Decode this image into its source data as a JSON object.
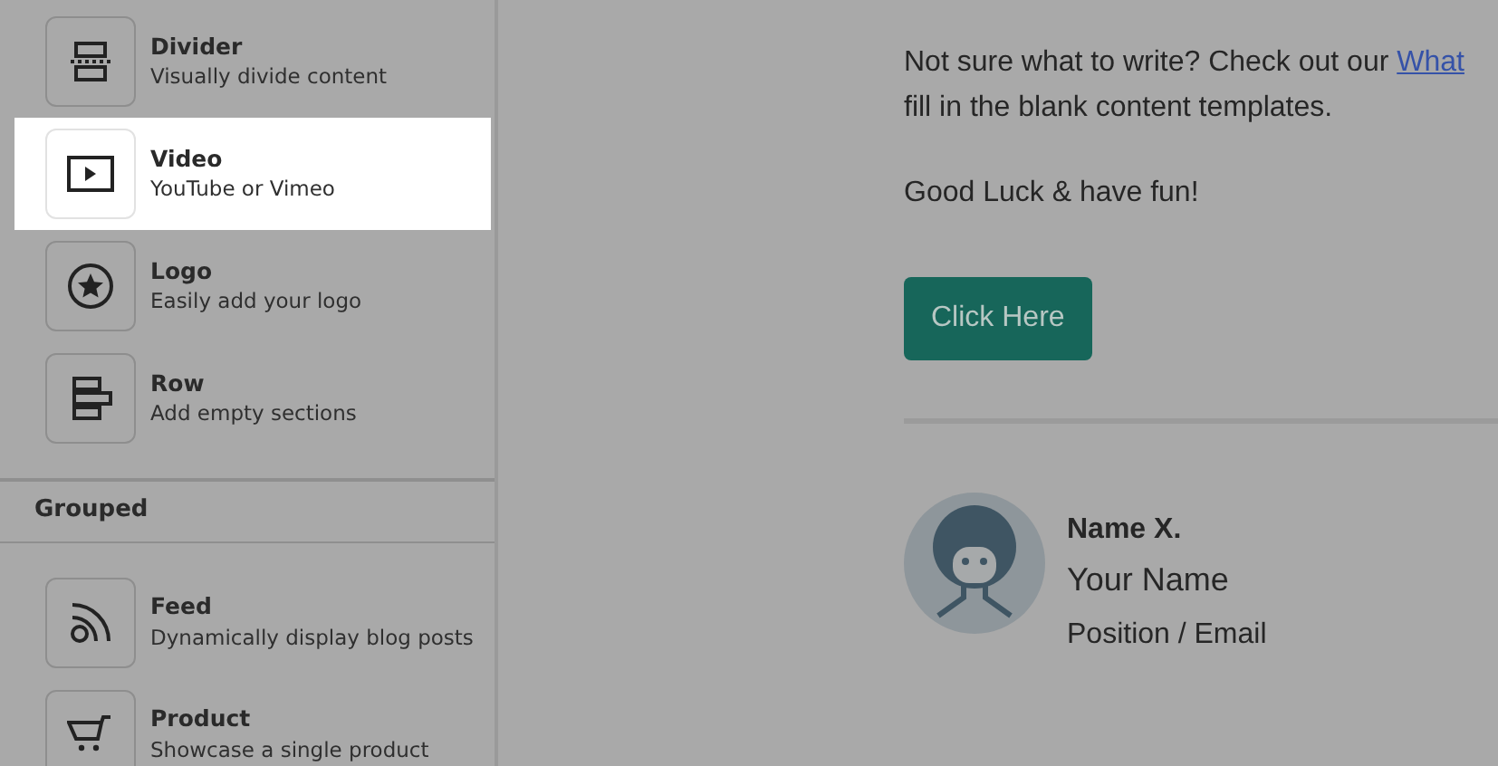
{
  "sidebar": {
    "sections": [
      {
        "items": [
          {
            "title": "Divider",
            "subtitle": "Visually divide content",
            "selected": false
          },
          {
            "title": "Video",
            "subtitle": "YouTube or Vimeo",
            "selected": true
          },
          {
            "title": "Logo",
            "subtitle": "Easily add your logo",
            "selected": false
          },
          {
            "title": "Row",
            "subtitle": "Add empty sections",
            "selected": false
          }
        ]
      },
      {
        "heading": "Grouped",
        "items": [
          {
            "title": "Feed",
            "subtitle": "Dynamically display blog posts",
            "selected": false
          },
          {
            "title": "Product",
            "subtitle": "Showcase a single product",
            "selected": false
          }
        ]
      }
    ]
  },
  "content": {
    "intro_before_link": "Not sure what to write? Check out our",
    "link": "What",
    "intro_after_link": "fill in the blank content templates.",
    "closing": "Good Luck & have fun!",
    "button": "Click Here",
    "signature": {
      "name": "Name X.",
      "full_name": "Your Name",
      "position": "Position / Email"
    }
  }
}
